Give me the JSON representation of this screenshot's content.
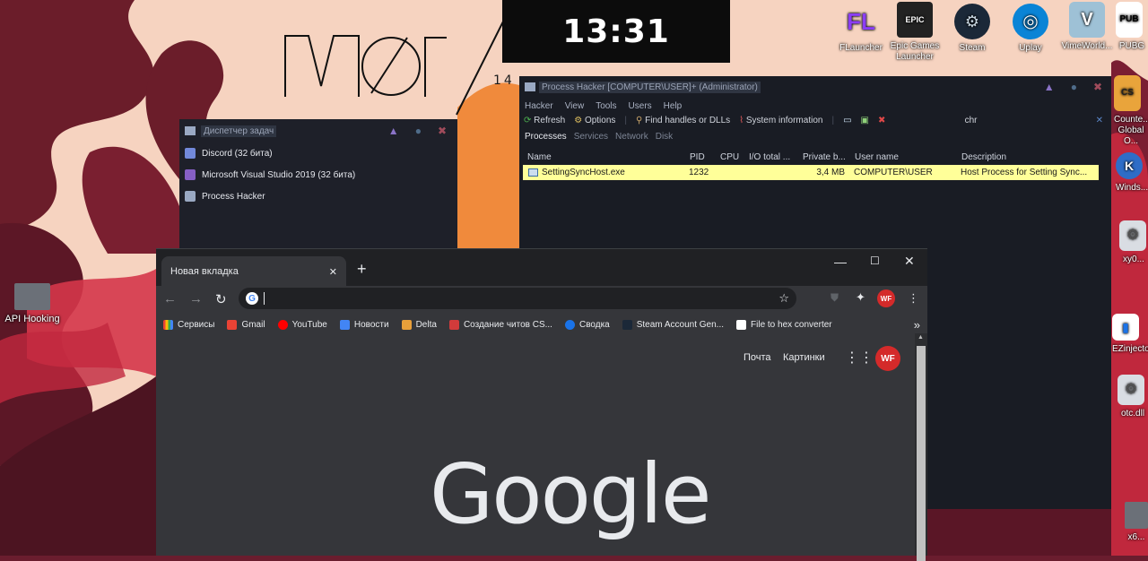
{
  "desktop": {
    "clock": "13:31",
    "date": "14",
    "icons_top": [
      {
        "label": "FLauncher",
        "icon": "flauncher-icon"
      },
      {
        "label": "Epic Games Launcher",
        "icon": "epic-games-icon"
      },
      {
        "label": "Steam",
        "icon": "steam-icon"
      },
      {
        "label": "Uplay",
        "icon": "uplay-icon"
      },
      {
        "label": "VimeWorld...",
        "icon": "vimeworld-icon"
      },
      {
        "label": "PUBG",
        "icon": "pubg-icon"
      }
    ],
    "icons_right": [
      {
        "label": "Counte... Global O...",
        "icon": "csgo-icon"
      },
      {
        "label": "Winds...",
        "icon": "winds-icon"
      },
      {
        "label": "xy0...",
        "icon": "dll-gear-icon"
      },
      {
        "label": "EZinjecto...",
        "icon": "ezinjector-icon"
      },
      {
        "label": "otc.dll",
        "icon": "dll-gear-icon"
      },
      {
        "label": "x6...",
        "icon": "folder-icon"
      }
    ],
    "icon_left": {
      "label": "API Hooking",
      "icon": "folder-icon"
    }
  },
  "taskmgr": {
    "title": "Диспетчер задач",
    "items": [
      {
        "label": "Discord (32 бита)",
        "icon": "discord-icon"
      },
      {
        "label": "Microsoft Visual Studio 2019 (32 бита)",
        "icon": "visual-studio-icon"
      },
      {
        "label": "Process Hacker",
        "icon": "process-hacker-icon"
      }
    ]
  },
  "ph": {
    "title": "Process Hacker [COMPUTER\\USER]+ (Administrator)",
    "menu": [
      "Hacker",
      "View",
      "Tools",
      "Users",
      "Help"
    ],
    "toolbar": {
      "refresh": "Refresh",
      "options": "Options",
      "find": "Find handles or DLLs",
      "sysinfo": "System information",
      "search_value": "chr"
    },
    "tabs": [
      "Processes",
      "Services",
      "Network",
      "Disk"
    ],
    "columns": [
      "Name",
      "PID",
      "CPU",
      "I/O total ...",
      "Private b...",
      "User name",
      "Description"
    ],
    "rows": [
      {
        "name": "SettingSyncHost.exe",
        "pid": "1232",
        "cpu": "",
        "io": "",
        "private": "3,4 MB",
        "user": "COMPUTER\\USER",
        "desc": "Host Process for Setting Sync..."
      }
    ]
  },
  "chrome": {
    "tab_title": "Новая вкладка",
    "omnibox_value": "",
    "bookmarks": [
      {
        "label": "Сервисы",
        "color": "#4285f4"
      },
      {
        "label": "Gmail",
        "color": "#ea4335"
      },
      {
        "label": "YouTube",
        "color": "#ff0000"
      },
      {
        "label": "Новости",
        "color": "#4285f4"
      },
      {
        "label": "Delta",
        "color": "#e8a03a"
      },
      {
        "label": "Создание читов CS...",
        "color": "#d23b3b"
      },
      {
        "label": "Сводка",
        "color": "#1a73e8"
      },
      {
        "label": "Steam Account Gen...",
        "color": "#1b2838"
      },
      {
        "label": "File to hex converter",
        "color": "#ffffff"
      }
    ],
    "more": "»",
    "page": {
      "links": [
        "Почта",
        "Картинки"
      ],
      "logo": "Google"
    }
  }
}
